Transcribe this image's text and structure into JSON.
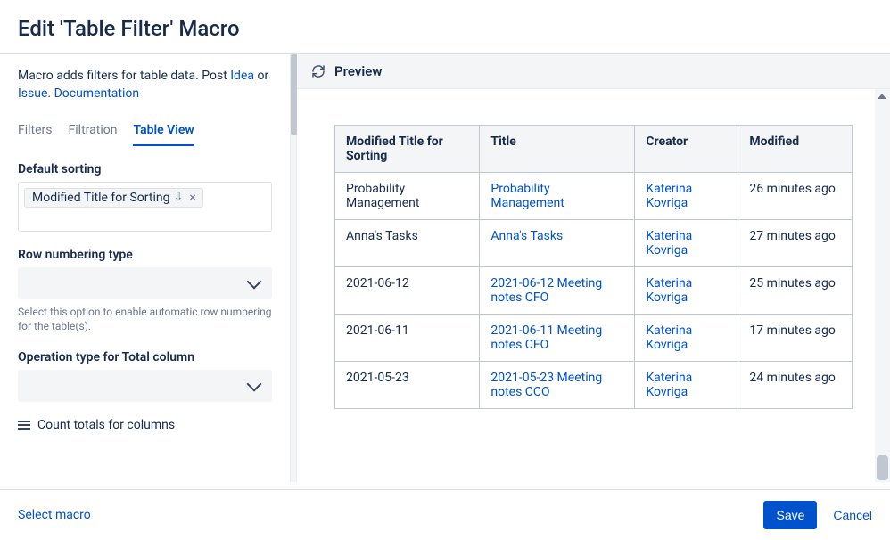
{
  "header": {
    "title": "Edit 'Table Filter' Macro"
  },
  "intro": {
    "prefix": "Macro adds filters for table data. Post ",
    "link_idea": "Idea",
    "mid1": " or ",
    "link_issue": "Issue",
    "mid2": ". ",
    "link_docs": "Documentation"
  },
  "tabs": {
    "items": [
      {
        "label": "Filters",
        "active": false
      },
      {
        "label": "Filtration",
        "active": false
      },
      {
        "label": "Table View",
        "active": true
      }
    ]
  },
  "default_sorting": {
    "label": "Default sorting",
    "chip_text": "Modified Title for Sorting",
    "chip_dir_glyph": "⇩"
  },
  "row_numbering": {
    "label": "Row numbering type",
    "help": "Select this option to enable automatic row numbering for the table(s)."
  },
  "operation_type": {
    "label": "Operation type for Total column"
  },
  "count_totals": {
    "label": "Count totals for columns"
  },
  "preview": {
    "title": "Preview",
    "columns": [
      "Modified Title for Sorting",
      "Title",
      "Creator",
      "Modified"
    ],
    "rows": [
      {
        "c0": "Probability Management",
        "c1": "Probability Management",
        "c2": "Katerina Kovriga",
        "c3": "26 minutes ago"
      },
      {
        "c0": "Anna's Tasks",
        "c1": "Anna's Tasks",
        "c2": "Katerina Kovriga",
        "c3": "27 minutes ago"
      },
      {
        "c0": "2021-06-12",
        "c1": "2021-06-12 Meeting notes CFO",
        "c2": "Katerina Kovriga",
        "c3": "25 minutes ago"
      },
      {
        "c0": "2021-06-11",
        "c1": "2021-06-11 Meeting notes CFO",
        "c2": "Katerina Kovriga",
        "c3": "17 minutes ago"
      },
      {
        "c0": "2021-05-23",
        "c1": "2021-05-23 Meeting notes CCO",
        "c2": "Katerina Kovriga",
        "c3": "24 minutes ago"
      }
    ]
  },
  "footer": {
    "select_macro": "Select macro",
    "save": "Save",
    "cancel": "Cancel"
  }
}
